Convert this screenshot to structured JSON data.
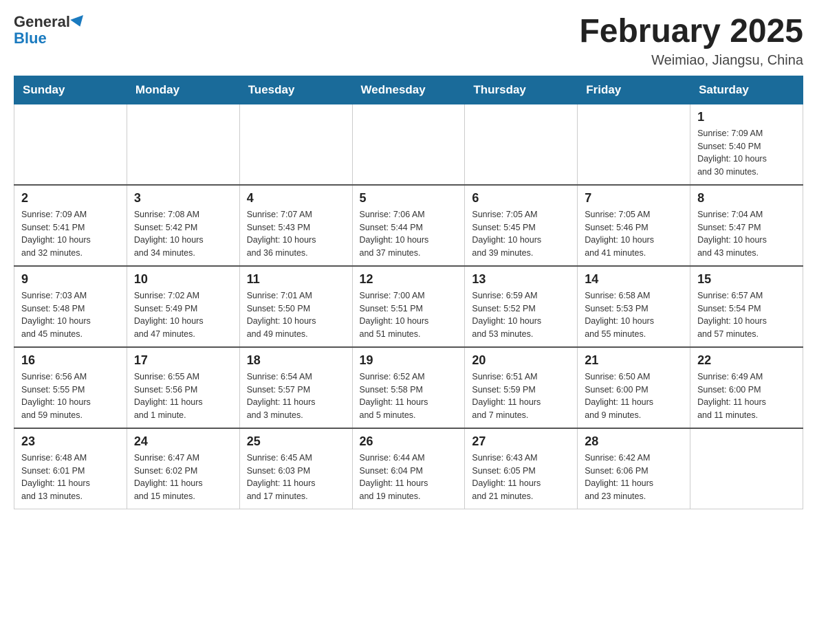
{
  "header": {
    "logo_general": "General",
    "logo_blue": "Blue",
    "title": "February 2025",
    "subtitle": "Weimiao, Jiangsu, China"
  },
  "days_of_week": [
    "Sunday",
    "Monday",
    "Tuesday",
    "Wednesday",
    "Thursday",
    "Friday",
    "Saturday"
  ],
  "weeks": [
    [
      {
        "day": "",
        "info": ""
      },
      {
        "day": "",
        "info": ""
      },
      {
        "day": "",
        "info": ""
      },
      {
        "day": "",
        "info": ""
      },
      {
        "day": "",
        "info": ""
      },
      {
        "day": "",
        "info": ""
      },
      {
        "day": "1",
        "info": "Sunrise: 7:09 AM\nSunset: 5:40 PM\nDaylight: 10 hours\nand 30 minutes."
      }
    ],
    [
      {
        "day": "2",
        "info": "Sunrise: 7:09 AM\nSunset: 5:41 PM\nDaylight: 10 hours\nand 32 minutes."
      },
      {
        "day": "3",
        "info": "Sunrise: 7:08 AM\nSunset: 5:42 PM\nDaylight: 10 hours\nand 34 minutes."
      },
      {
        "day": "4",
        "info": "Sunrise: 7:07 AM\nSunset: 5:43 PM\nDaylight: 10 hours\nand 36 minutes."
      },
      {
        "day": "5",
        "info": "Sunrise: 7:06 AM\nSunset: 5:44 PM\nDaylight: 10 hours\nand 37 minutes."
      },
      {
        "day": "6",
        "info": "Sunrise: 7:05 AM\nSunset: 5:45 PM\nDaylight: 10 hours\nand 39 minutes."
      },
      {
        "day": "7",
        "info": "Sunrise: 7:05 AM\nSunset: 5:46 PM\nDaylight: 10 hours\nand 41 minutes."
      },
      {
        "day": "8",
        "info": "Sunrise: 7:04 AM\nSunset: 5:47 PM\nDaylight: 10 hours\nand 43 minutes."
      }
    ],
    [
      {
        "day": "9",
        "info": "Sunrise: 7:03 AM\nSunset: 5:48 PM\nDaylight: 10 hours\nand 45 minutes."
      },
      {
        "day": "10",
        "info": "Sunrise: 7:02 AM\nSunset: 5:49 PM\nDaylight: 10 hours\nand 47 minutes."
      },
      {
        "day": "11",
        "info": "Sunrise: 7:01 AM\nSunset: 5:50 PM\nDaylight: 10 hours\nand 49 minutes."
      },
      {
        "day": "12",
        "info": "Sunrise: 7:00 AM\nSunset: 5:51 PM\nDaylight: 10 hours\nand 51 minutes."
      },
      {
        "day": "13",
        "info": "Sunrise: 6:59 AM\nSunset: 5:52 PM\nDaylight: 10 hours\nand 53 minutes."
      },
      {
        "day": "14",
        "info": "Sunrise: 6:58 AM\nSunset: 5:53 PM\nDaylight: 10 hours\nand 55 minutes."
      },
      {
        "day": "15",
        "info": "Sunrise: 6:57 AM\nSunset: 5:54 PM\nDaylight: 10 hours\nand 57 minutes."
      }
    ],
    [
      {
        "day": "16",
        "info": "Sunrise: 6:56 AM\nSunset: 5:55 PM\nDaylight: 10 hours\nand 59 minutes."
      },
      {
        "day": "17",
        "info": "Sunrise: 6:55 AM\nSunset: 5:56 PM\nDaylight: 11 hours\nand 1 minute."
      },
      {
        "day": "18",
        "info": "Sunrise: 6:54 AM\nSunset: 5:57 PM\nDaylight: 11 hours\nand 3 minutes."
      },
      {
        "day": "19",
        "info": "Sunrise: 6:52 AM\nSunset: 5:58 PM\nDaylight: 11 hours\nand 5 minutes."
      },
      {
        "day": "20",
        "info": "Sunrise: 6:51 AM\nSunset: 5:59 PM\nDaylight: 11 hours\nand 7 minutes."
      },
      {
        "day": "21",
        "info": "Sunrise: 6:50 AM\nSunset: 6:00 PM\nDaylight: 11 hours\nand 9 minutes."
      },
      {
        "day": "22",
        "info": "Sunrise: 6:49 AM\nSunset: 6:00 PM\nDaylight: 11 hours\nand 11 minutes."
      }
    ],
    [
      {
        "day": "23",
        "info": "Sunrise: 6:48 AM\nSunset: 6:01 PM\nDaylight: 11 hours\nand 13 minutes."
      },
      {
        "day": "24",
        "info": "Sunrise: 6:47 AM\nSunset: 6:02 PM\nDaylight: 11 hours\nand 15 minutes."
      },
      {
        "day": "25",
        "info": "Sunrise: 6:45 AM\nSunset: 6:03 PM\nDaylight: 11 hours\nand 17 minutes."
      },
      {
        "day": "26",
        "info": "Sunrise: 6:44 AM\nSunset: 6:04 PM\nDaylight: 11 hours\nand 19 minutes."
      },
      {
        "day": "27",
        "info": "Sunrise: 6:43 AM\nSunset: 6:05 PM\nDaylight: 11 hours\nand 21 minutes."
      },
      {
        "day": "28",
        "info": "Sunrise: 6:42 AM\nSunset: 6:06 PM\nDaylight: 11 hours\nand 23 minutes."
      },
      {
        "day": "",
        "info": ""
      }
    ]
  ]
}
